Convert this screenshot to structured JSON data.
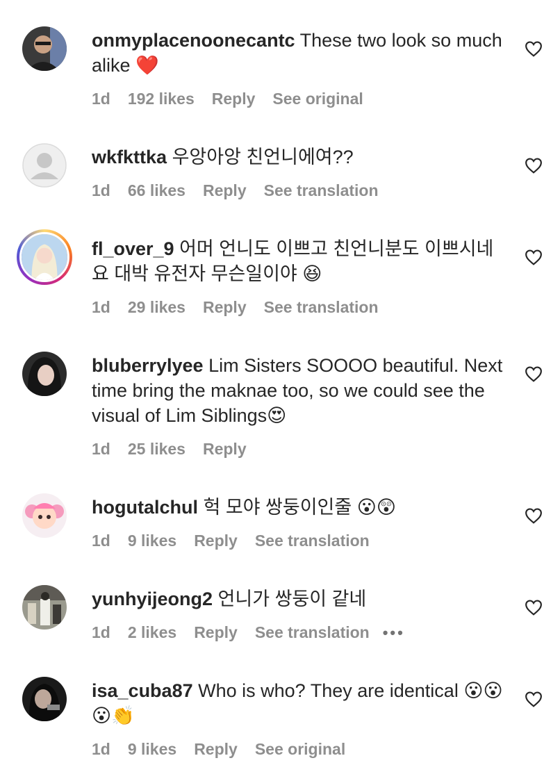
{
  "comments": [
    {
      "username": "onmyplacenoonecantc",
      "text": "These two look so much alike ❤️",
      "time": "1d",
      "likes": "192 likes",
      "reply": "Reply",
      "translate": "See original"
    },
    {
      "username": "wkfkttka",
      "text": "우앙아앙 친언니에여??",
      "time": "1d",
      "likes": "66 likes",
      "reply": "Reply",
      "translate": "See translation"
    },
    {
      "username": "fl_over_9",
      "text": "어머 언니도 이쁘고 친언니분도 이쁘시네요 대박 유전자 무슨일이야 😆",
      "time": "1d",
      "likes": "29 likes",
      "reply": "Reply",
      "translate": "See translation"
    },
    {
      "username": "bluberrylyee",
      "text": "Lim Sisters SOOOO beautiful. Next time bring the maknae too, so we could see the visual of Lim Siblings😍",
      "time": "1d",
      "likes": "25 likes",
      "reply": "Reply"
    },
    {
      "username": "hogutalchul",
      "text": "헉 모야 쌍둥이인줄 😮😲",
      "time": "1d",
      "likes": "9 likes",
      "reply": "Reply",
      "translate": "See translation"
    },
    {
      "username": "yunhyijeong2",
      "text": "언니가 쌍둥이 같네",
      "time": "1d",
      "likes": "2 likes",
      "reply": "Reply",
      "translate": "See translation",
      "more": "•••"
    },
    {
      "username": "isa_cuba87",
      "text": "Who is who? They are identical 😮😮😮👏",
      "time": "1d",
      "likes": "9 likes",
      "reply": "Reply",
      "translate": "See original"
    }
  ],
  "icons": {
    "heart": "heart-outline-icon",
    "more": "more-options-icon"
  },
  "colors": {
    "text": "#262626",
    "meta": "#8e8e8e"
  }
}
